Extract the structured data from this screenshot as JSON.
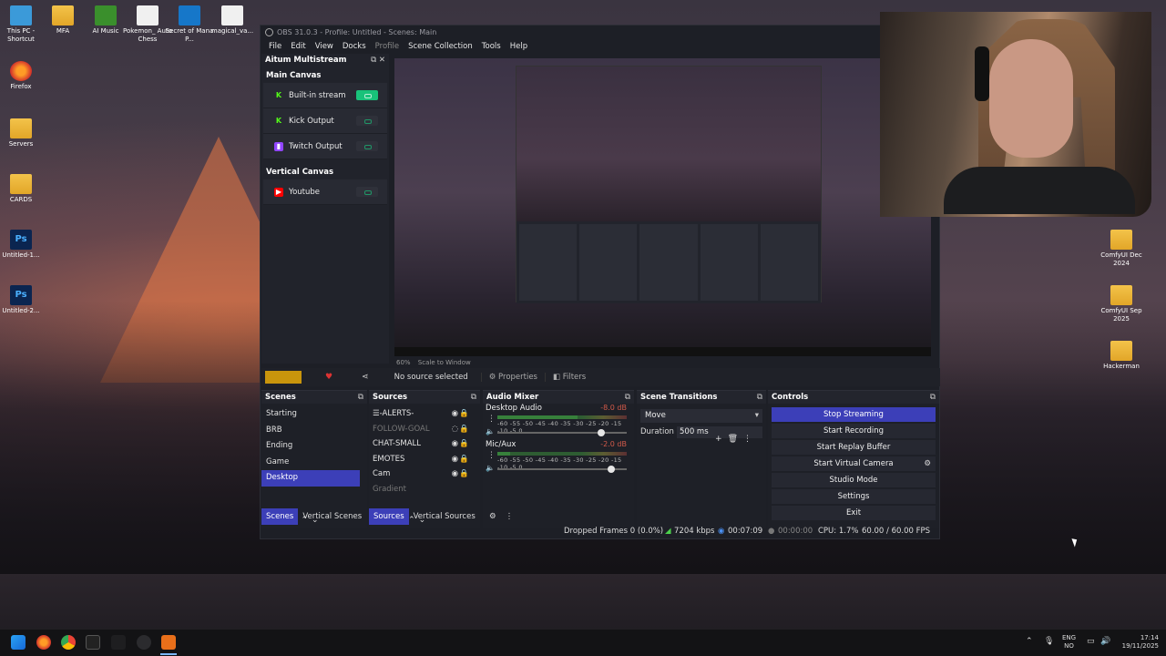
{
  "desktop": {
    "left_icons": [
      {
        "label": "This PC - Shortcut",
        "icon": "pc-icon"
      },
      {
        "label": "Firefox",
        "icon": "firefox-icon"
      },
      {
        "label": "Servers",
        "icon": "folder-icon"
      },
      {
        "label": "CARDS",
        "icon": "folder-icon"
      },
      {
        "label": "Untitled-1...",
        "icon": "photoshop-file-icon"
      },
      {
        "label": "Untitled-2...",
        "icon": "photoshop-file-icon"
      }
    ],
    "top_icons": [
      {
        "label": "MFA",
        "icon": "folder-icon"
      },
      {
        "label": "AI Music",
        "icon": "folder-icon"
      },
      {
        "label": "Pokemon_ Auto Chess",
        "icon": "game-icon"
      },
      {
        "label": "Secret of Mana P...",
        "icon": "app-icon"
      },
      {
        "label": "magical_va...",
        "icon": "file-icon"
      }
    ],
    "right_icons": [
      {
        "label": "ComfyUI Dec 2024",
        "icon": "folder-icon"
      },
      {
        "label": "ComfyUI Sep 2025",
        "icon": "folder-icon"
      },
      {
        "label": "Hackerman",
        "icon": "folder-icon"
      }
    ]
  },
  "obs": {
    "title": "OBS 31.0.3 - Profile: Untitled - Scenes: Main",
    "menu": [
      "File",
      "Edit",
      "View",
      "Docks",
      "Profile",
      "Scene Collection",
      "Tools",
      "Help"
    ],
    "multistream": {
      "title": "Aitum Multistream",
      "main_canvas_title": "Main Canvas",
      "main_outputs": [
        {
          "label": "Built-in stream",
          "on": true,
          "color": "#19c27a"
        },
        {
          "label": "Kick Output",
          "on": false,
          "color": "#53fc18"
        },
        {
          "label": "Twitch Output",
          "on": false,
          "color": "#9146ff"
        }
      ],
      "vertical_canvas_title": "Vertical Canvas",
      "vertical_outputs": [
        {
          "label": "Youtube",
          "on": false,
          "color": "#ff0000"
        }
      ]
    },
    "preview": {
      "zoom": "60%",
      "scale_label": "Scale to Window"
    },
    "source_toolbar": {
      "no_source": "No source selected",
      "properties": "Properties",
      "filters": "Filters"
    },
    "scenes": {
      "title": "Scenes",
      "items": [
        "Starting",
        "BRB",
        "Ending",
        "Game",
        "Desktop"
      ],
      "selected": "Desktop"
    },
    "sources": {
      "title": "Sources",
      "items": [
        {
          "label": "☰-ALERTS-",
          "faded": false
        },
        {
          "label": "FOLLOW-GOAL",
          "faded": true
        },
        {
          "label": "CHAT-SMALL",
          "faded": false
        },
        {
          "label": "EMOTES",
          "faded": false
        },
        {
          "label": "Cam",
          "faded": false
        },
        {
          "label": "Gradient",
          "faded": true
        }
      ]
    },
    "audio_mixer": {
      "title": "Audio Mixer",
      "ticks": "-60 -55 -50 -45 -40 -35 -30 -25 -20 -15 -10 -5 0",
      "channels": [
        {
          "name": "Desktop Audio",
          "db": "-8.0 dB",
          "level": 0.62,
          "volume": 0.8
        },
        {
          "name": "Mic/Aux",
          "db": "-2.0 dB",
          "level": 0.1,
          "volume": 0.88
        }
      ]
    },
    "scene_transitions": {
      "title": "Scene Transitions",
      "transition": "Move",
      "duration_label": "Duration",
      "duration_value": "500 ms"
    },
    "controls": {
      "title": "Controls",
      "buttons": [
        "Stop Streaming",
        "Start Recording",
        "Start Replay Buffer",
        "Start Virtual Camera",
        "Studio Mode",
        "Settings",
        "Exit"
      ]
    },
    "tabs": {
      "scenes_tabs": [
        "Scenes",
        "Vertical Scenes"
      ],
      "sources_tabs": [
        "Sources",
        "Vertical Sources"
      ]
    },
    "status": {
      "dropped": "Dropped Frames 0 (0.0%)",
      "bitrate": "7204 kbps",
      "stream_time": "00:07:09",
      "rec_time": "00:00:00",
      "cpu": "CPU: 1.7%",
      "fps": "60.00 / 60.00 FPS"
    }
  },
  "taskbar": {
    "lang_top": "ENG",
    "lang_bottom": "NO",
    "time": "17:14",
    "date": "19/11/2025"
  }
}
